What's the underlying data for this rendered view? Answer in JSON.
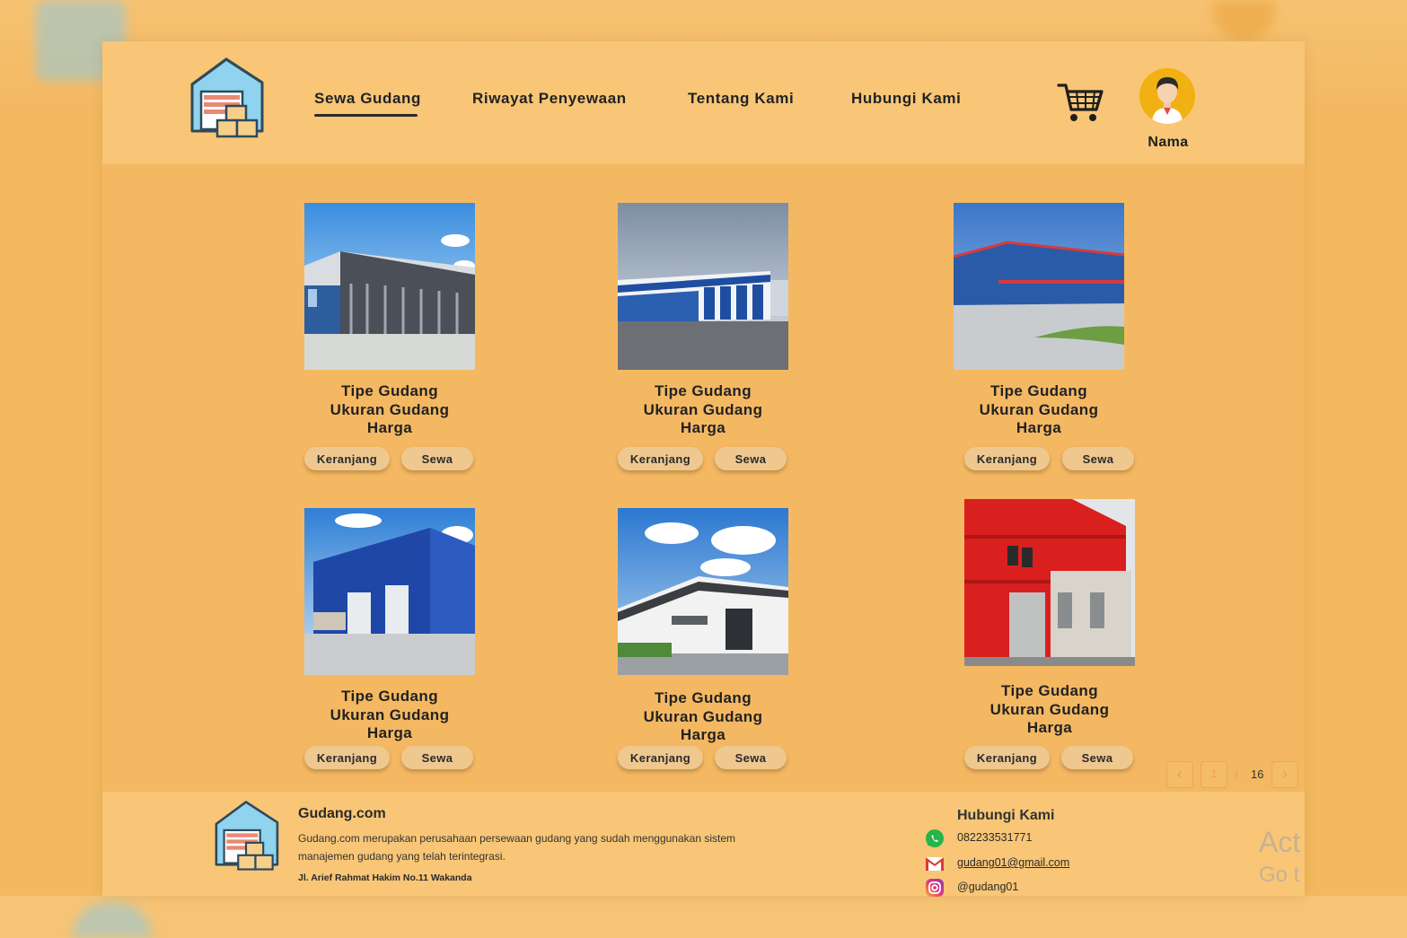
{
  "app": {
    "nav": [
      {
        "label": "Sewa Gudang",
        "active": true
      },
      {
        "label": "Riwayat Penyewaan",
        "active": false
      },
      {
        "label": "Tentang Kami",
        "active": false
      },
      {
        "label": "Hubungi Kami",
        "active": false
      }
    ],
    "cart_icon": "shopping-cart-icon",
    "user": {
      "name": "Nama",
      "avatar_icon": "user-avatar-icon"
    }
  },
  "products": [
    {
      "type": "Tipe Gudang",
      "size": "Ukuran Gudang",
      "price": "Harga",
      "cart_label": "Keranjang",
      "rent_label": "Sewa",
      "photo": "open-hangar-warehouse"
    },
    {
      "type": "Tipe Gudang",
      "size": "Ukuran Gudang",
      "price": "Harga",
      "cart_label": "Keranjang",
      "rent_label": "Sewa",
      "photo": "long-blue-white-warehouse"
    },
    {
      "type": "Tipe Gudang",
      "size": "Ukuran Gudang",
      "price": "Harga",
      "cart_label": "Keranjang",
      "rent_label": "Sewa",
      "photo": "blue-red-warehouse"
    },
    {
      "type": "Tipe Gudang",
      "size": "Ukuran Gudang",
      "price": "Harga",
      "cart_label": "Keranjang",
      "rent_label": "Sewa",
      "photo": "blue-steel-warehouse"
    },
    {
      "type": "Tipe Gudang",
      "size": "Ukuran Gudang",
      "price": "Harga",
      "cart_label": "Keranjang",
      "rent_label": "Sewa",
      "photo": "white-grey-warehouse"
    },
    {
      "type": "Tipe Gudang",
      "size": "Ukuran Gudang",
      "price": "Harga",
      "cart_label": "Keranjang",
      "rent_label": "Sewa",
      "photo": "red-facade-warehouse"
    }
  ],
  "pagination": {
    "current": "1",
    "separator": "/",
    "total": "16"
  },
  "footer": {
    "brand": "Gudang.com",
    "description": "Gudang.com merupakan perusahaan persewaan gudang yang sudah menggunakan sistem manajemen gudang yang telah terintegrasi.",
    "address": "Jl. Arief Rahmat Hakim No.11 Wakanda",
    "contact_title": "Hubungi Kami",
    "contacts": [
      {
        "icon": "whatsapp-icon",
        "value": "082233531771"
      },
      {
        "icon": "gmail-icon",
        "value": "gudang01@gmail.com"
      },
      {
        "icon": "instagram-icon",
        "value": "@gudang01"
      }
    ]
  },
  "watermark": {
    "line1": "Act",
    "line2": "Go t"
  },
  "colors": {
    "background": "#f4b95e",
    "header": "#f8c676",
    "button": "#efc890",
    "avatar": "#f2b112"
  }
}
